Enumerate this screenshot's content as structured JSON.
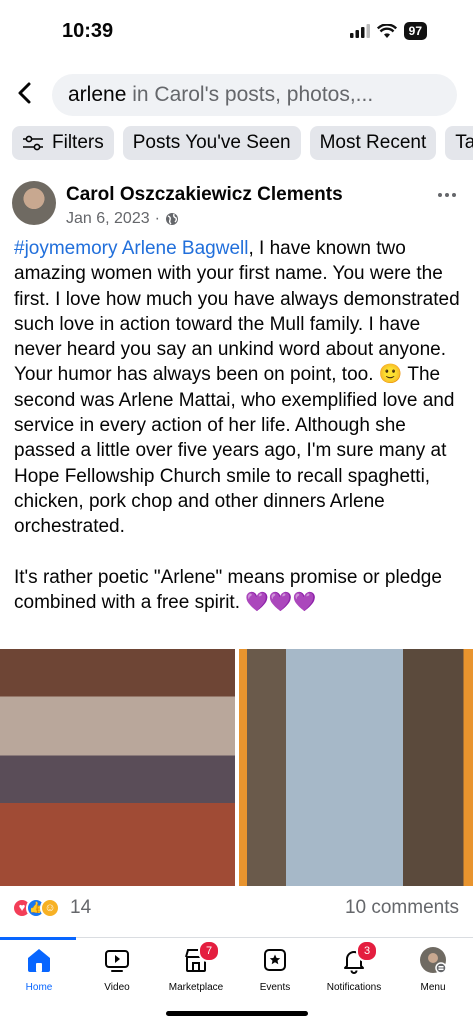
{
  "status": {
    "time": "10:39",
    "battery": "97"
  },
  "search": {
    "query": "arlene",
    "suffix": " in Carol's posts, photos,..."
  },
  "filters": [
    {
      "label": "Filters"
    },
    {
      "label": "Posts You've Seen"
    },
    {
      "label": "Most Recent"
    },
    {
      "label": "Ta"
    }
  ],
  "post": {
    "author": "Carol Oszczakiewicz Clements",
    "date": "Jan 6, 2023",
    "meta_sep": "·",
    "hashtag": "#joymemory",
    "mention": "Arlene Bagwell",
    "paragraph1_rest": ", I have known two amazing women with your first name.  You were the first.  I love how much you have always demonstrated such love in action toward the Mull family. I have never heard you say an unkind word about anyone.  Your humor has always been on point, too. 🙂   The second was Arlene Mattai, who exemplified love and service in every action of her life.  Although she passed a little over five years ago, I'm sure many at Hope Fellowship Church smile to recall spaghetti, chicken, pork chop and other dinners Arlene orchestrated.",
    "paragraph2": " It's rather poetic \"Arlene\" means promise or pledge combined with a free spirit. 💜💜💜",
    "reaction_count": "14",
    "comments": "10 comments"
  },
  "tabs": [
    {
      "label": "Home",
      "icon": "home-icon"
    },
    {
      "label": "Video",
      "icon": "video-icon"
    },
    {
      "label": "Marketplace",
      "icon": "marketplace-icon",
      "badge": "7"
    },
    {
      "label": "Events",
      "icon": "events-icon"
    },
    {
      "label": "Notifications",
      "icon": "bell-icon",
      "badge": "3"
    },
    {
      "label": "Menu",
      "icon": "menu-avatar"
    }
  ],
  "colors": {
    "accent": "#0866ff",
    "link": "#216fdb",
    "badge": "#e41e3f"
  }
}
